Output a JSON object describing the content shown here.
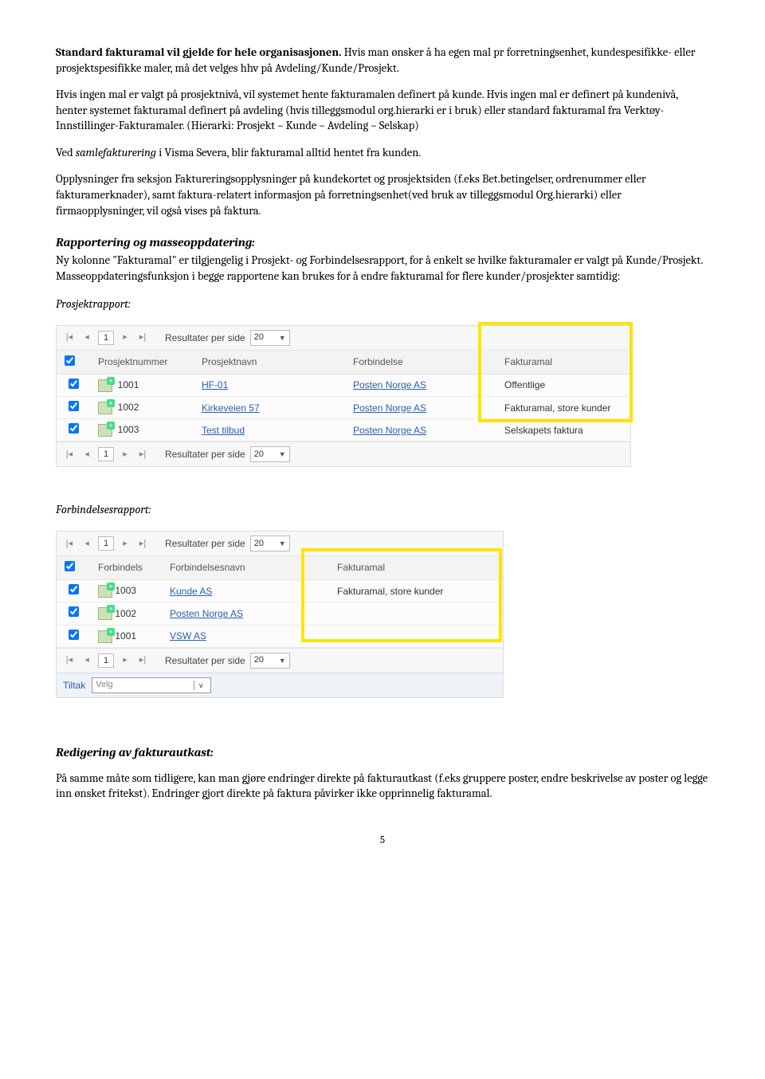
{
  "p1_lead": "Standard fakturamal vil gjelde for hele organisasjonen.",
  "p1_rest": " Hvis man ønsker å ha egen mal pr forretningsenhet, kundespesifikke- eller prosjektspesifikke maler, må det velges hhv på Avdeling/Kunde/Prosjekt.",
  "p2": "Hvis ingen mal er valgt på prosjektnivå, vil systemet hente fakturamalen definert på kunde. Hvis ingen mal er definert på kundenivå, henter systemet fakturamal definert på avdeling (hvis tilleggsmodul org.hierarki er i bruk) eller standard fakturamal fra Verktøy-Innstillinger-Fakturamaler. (Hierarki: Prosjekt – Kunde – Avdeling – Selskap)",
  "p3_a": "Ved ",
  "p3_em": "samlefakturering",
  "p3_b": " i Visma Severa, blir fakturamal alltid hentet fra kunden.",
  "p4": "Opplysninger fra seksjon Faktureringsopplysninger på kundekortet og prosjektsiden (f.eks Bet.betingelser, ordrenummer eller fakturamerknader), samt faktura-relatert informasjon på forretningsenhet(ved bruk av tilleggsmodul Org.hierarki) eller firmaopplysninger, vil også vises på faktura.",
  "sec1_title": "Rapportering og masseoppdatering:",
  "sec1_body": "Ny kolonne \"Fakturamal\" er tilgjengelig i Prosjekt- og Forbindelsesrapport, for å enkelt se hvilke fakturamaler er valgt på Kunde/Prosjekt. Masseoppdateringsfunksjon i begge rapportene kan brukes for å endre fakturamal for flere kunder/prosjekter samtidig:",
  "sub_prosjekt": "Prosjektrapport:",
  "sub_forbindelse": "Forbindelsesrapport:",
  "pager": {
    "first": "|◂",
    "prev": "◂",
    "page": "1",
    "next": "▸",
    "last": "▸|",
    "results_label": "Resultater per side",
    "results_value": "20"
  },
  "prosjekt": {
    "cols": [
      "Prosjektnummer",
      "Prosjektnavn",
      "Forbindelse",
      "Fakturamal"
    ],
    "rows": [
      {
        "num": "1001",
        "navn": "HF-01",
        "forb": "Posten Norge AS",
        "mal": "Offentlige"
      },
      {
        "num": "1002",
        "navn": "Kirkeveien 57",
        "forb": "Posten Norge AS",
        "mal": "Fakturamal, store kunder"
      },
      {
        "num": "1003",
        "navn": "Test tilbud",
        "forb": "Posten Norge AS",
        "mal": "Selskapets faktura"
      }
    ]
  },
  "forbindelse": {
    "cols": [
      "Forbindels",
      "Forbindelsesnavn",
      "Fakturamal"
    ],
    "rows": [
      {
        "num": "1003",
        "navn": "Kunde AS",
        "mal": "Fakturamal, store kunder"
      },
      {
        "num": "1002",
        "navn": "Posten Norge AS",
        "mal": ""
      },
      {
        "num": "1001",
        "navn": "VSW AS",
        "mal": ""
      }
    ],
    "tiltak_label": "Tiltak",
    "tiltak_value": "Velg"
  },
  "sec2_title": "Redigering av fakturautkast:",
  "sec2_body": "På samme måte som tidligere, kan man gjøre endringer direkte på fakturautkast (f.eks gruppere poster, endre beskrivelse av poster og legge inn ønsket fritekst). Endringer gjort direkte på faktura påvirker ikke opprinnelig fakturamal.",
  "page_number": "5"
}
